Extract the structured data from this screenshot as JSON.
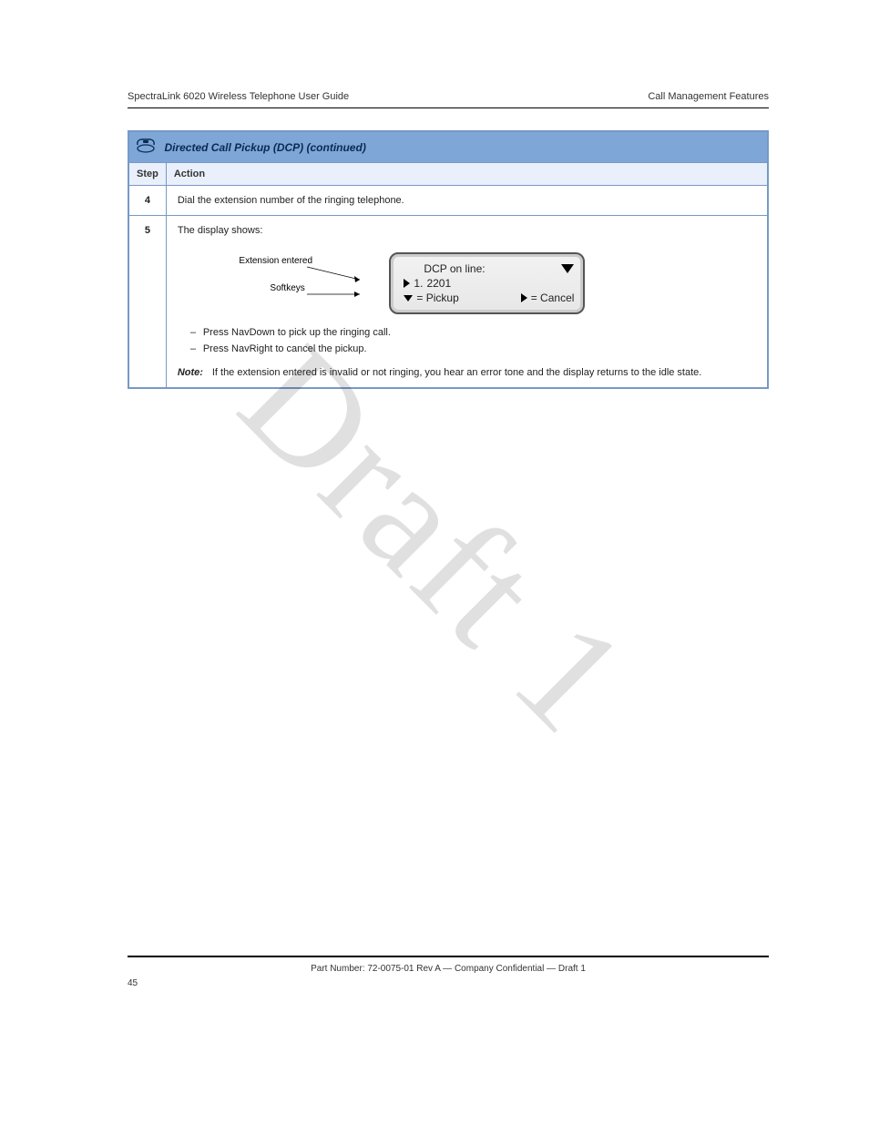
{
  "header": {
    "left": "SpectraLink 6020 Wireless Telephone User Guide",
    "right": "Call Management Features"
  },
  "proc": {
    "title": "Directed Call Pickup (DCP) (continued)",
    "columns": {
      "step": "Step",
      "action": "Action"
    },
    "rows": [
      {
        "step": "4",
        "action": "Dial the extension number of the ringing telephone."
      },
      {
        "step": "5",
        "intro": "The display shows:",
        "lcd": {
          "line1_label": "DCP on line:",
          "line2_prefix": "1.",
          "line2_value": "2201",
          "line3_left": "= Pickup",
          "line3_right": "= Cancel"
        },
        "callouts": {
          "ext": "Extension entered",
          "softkeys": "Softkeys"
        },
        "bullets": [
          "Press NavDown to pick up the ringing call.",
          "Press NavRight to cancel the pickup."
        ],
        "note_label": "Note:",
        "note_body": "If the extension entered is invalid or not ringing, you hear an error tone and the display returns to the idle state."
      }
    ]
  },
  "watermark": "Draft 1",
  "footer": {
    "line": "Part Number: 72-0075-01 Rev A — Company Confidential — Draft 1",
    "page": "45"
  }
}
